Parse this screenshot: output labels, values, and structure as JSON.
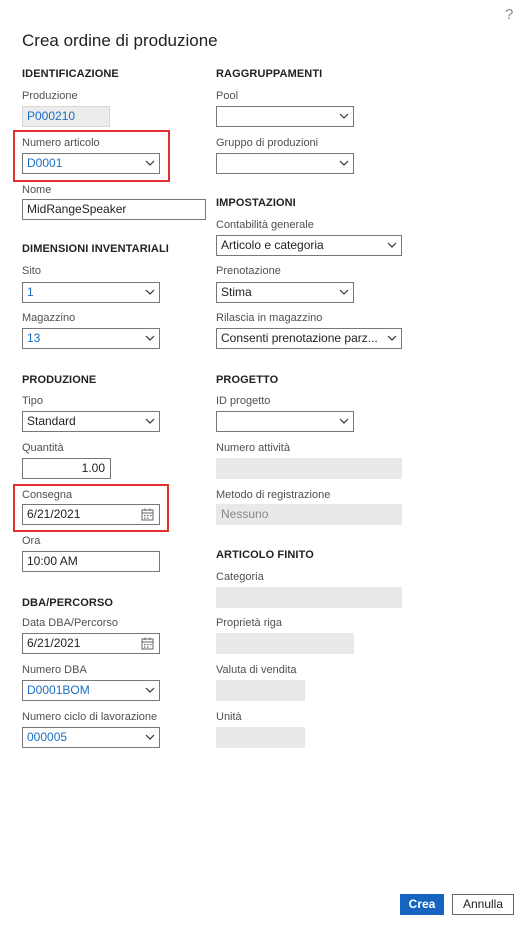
{
  "dialog": {
    "title": "Crea ordine di produzione",
    "help": "?"
  },
  "identificazione": {
    "heading": "IDENTIFICAZIONE",
    "produzione_label": "Produzione",
    "produzione_value": "P000210",
    "numero_articolo_label": "Numero articolo",
    "numero_articolo_value": "D0001",
    "nome_label": "Nome",
    "nome_value": "MidRangeSpeaker"
  },
  "dimensioni": {
    "heading": "DIMENSIONI INVENTARIALI",
    "sito_label": "Sito",
    "sito_value": "1",
    "magazzino_label": "Magazzino",
    "magazzino_value": "13"
  },
  "produzione": {
    "heading": "PRODUZIONE",
    "tipo_label": "Tipo",
    "tipo_value": "Standard",
    "quantita_label": "Quantità",
    "quantita_value": "1.00",
    "consegna_label": "Consegna",
    "consegna_value": "6/21/2021",
    "ora_label": "Ora",
    "ora_value": "10:00 AM"
  },
  "dba": {
    "heading": "DBA/PERCORSO",
    "data_label": "Data DBA/Percorso",
    "data_value": "6/21/2021",
    "numero_dba_label": "Numero DBA",
    "numero_dba_value": "D0001BOM",
    "ciclo_label": "Numero ciclo di lavorazione",
    "ciclo_value": "000005"
  },
  "raggruppamenti": {
    "heading": "RAGGRUPPAMENTI",
    "pool_label": "Pool",
    "pool_value": "",
    "gruppo_label": "Gruppo di produzioni",
    "gruppo_value": ""
  },
  "impostazioni": {
    "heading": "IMPOSTAZIONI",
    "contabilita_label": "Contabilità generale",
    "contabilita_value": "Articolo e categoria",
    "prenotazione_label": "Prenotazione",
    "prenotazione_value": "Stima",
    "rilascia_label": "Rilascia in magazzino",
    "rilascia_value": "Consenti prenotazione parz..."
  },
  "progetto": {
    "heading": "PROGETTO",
    "id_label": "ID progetto",
    "id_value": "",
    "attivita_label": "Numero attività",
    "attivita_value": "",
    "metodo_label": "Metodo di registrazione",
    "metodo_value": "Nessuno"
  },
  "articolo_finito": {
    "heading": "ARTICOLO FINITO",
    "categoria_label": "Categoria",
    "categoria_value": "",
    "proprieta_label": "Proprietà riga",
    "proprieta_value": "",
    "valuta_label": "Valuta di vendita",
    "valuta_value": "",
    "unita_label": "Unità",
    "unita_value": ""
  },
  "buttons": {
    "crea": "Crea",
    "annulla": "Annulla"
  },
  "colors": {
    "primary": "#1565c0",
    "highlight": "#e03030",
    "link": "#1a6fc4"
  },
  "icons": [
    "help-icon",
    "chevron-down-icon",
    "calendar-icon"
  ]
}
